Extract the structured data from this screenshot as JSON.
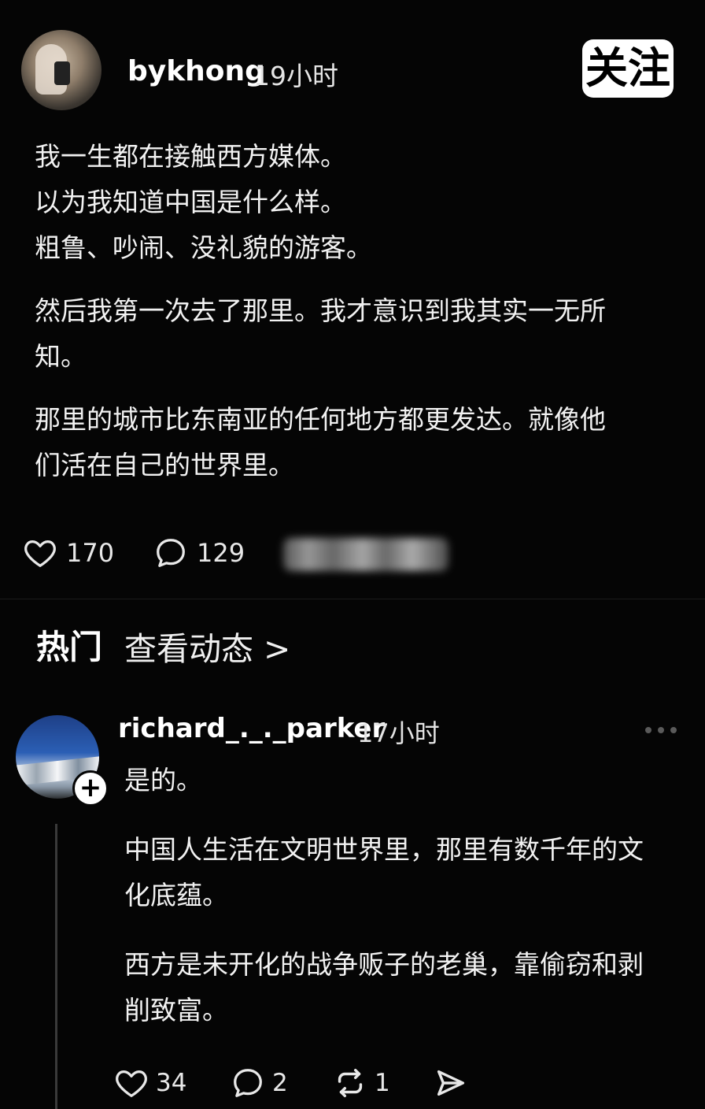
{
  "post": {
    "username": "bykhong",
    "time": "19小时",
    "follow_label": "关注",
    "paragraphs": [
      [
        "我一生都在接触西方媒体。",
        "以为我知道中国是什么样。",
        "粗鲁、吵闹、没礼貌的游客。"
      ],
      [
        "然后我第一次去了那里。我才意识到我其实一无所",
        "知。"
      ],
      [
        "那里的城市比东南亚的任何地方都更发达。就像他",
        "们活在自己的世界里。"
      ]
    ],
    "likes": "170",
    "comments": "129"
  },
  "section": {
    "hot": "热门",
    "view_activity": "查看动态 >"
  },
  "comment": {
    "username": "richard_._._parker",
    "time": "17小时",
    "paragraphs": [
      [
        "是的。"
      ],
      [
        "中国人生活在文明世界里，那里有数千年的文",
        "化底蕴。"
      ],
      [
        "西方是未开化的战争贩子的老巢，靠偷窃和剥",
        "削致富。"
      ]
    ],
    "likes": "34",
    "replies": "2",
    "reposts": "1"
  },
  "icons": {
    "like": "heart-icon",
    "comment": "speech-bubble-icon",
    "repost": "repost-icon",
    "share": "send-icon",
    "more": "more-dots-icon",
    "follow_add": "plus-icon"
  }
}
